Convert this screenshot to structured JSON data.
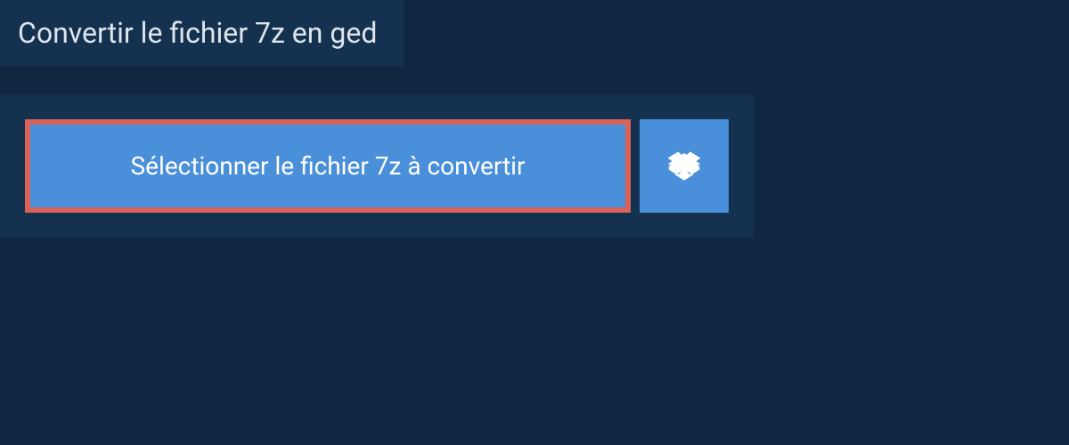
{
  "heading": "Convertir le fichier 7z en ged",
  "buttons": {
    "select_file_label": "Sélectionner le fichier 7z à convertir"
  },
  "colors": {
    "page_bg": "#0f2740",
    "panel_bg": "#14314f",
    "button_bg": "#4a8fd9",
    "highlight_border": "#d96359",
    "text_light": "#dde5ec"
  }
}
